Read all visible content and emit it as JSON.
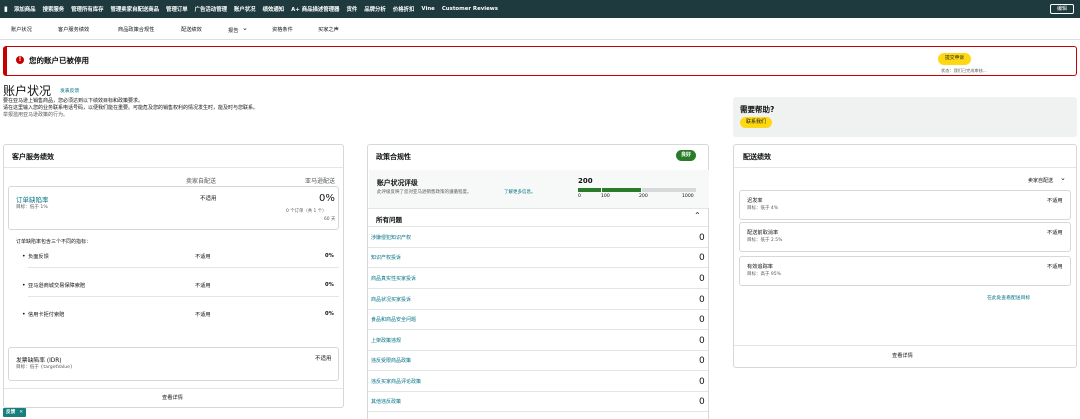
{
  "topnav": {
    "items": [
      "添加商品",
      "搜索服务",
      "管理所有库存",
      "管理卖家自配送商品",
      "管理订单",
      "广告活动管理",
      "账户状况",
      "绩效通知",
      "A+ 商品描述管理器",
      "货件",
      "品牌分析",
      "价格折扣",
      "Vine",
      "Customer Reviews"
    ],
    "edit_label": "编辑"
  },
  "subnav": {
    "items": [
      "账户状况",
      "客户服务绩效",
      "商品政策合规性",
      "配送绩效",
      "报告",
      "资格条件",
      "买家之声"
    ]
  },
  "alert": {
    "icon_char": "!",
    "message": "您的账户已被停用",
    "appeal_label": "提交申诉",
    "appeal_status": "状态：我们已完成审核..."
  },
  "header": {
    "title": "账户状况",
    "feedback_link": "发表反馈",
    "desc_lines": [
      "要在亚马逊上销售商品，您必须达到以下绩效目标和政策要求。",
      "请在这里输入您的业务联系电话号码，以便我们能在重要。可能危及您的销售权利的情况发生时，能及时与您联系。"
    ],
    "desc_muted": "举报滥用亚马逊政策的行为。"
  },
  "help": {
    "title": "需要帮助?",
    "button": "联系我们"
  },
  "customer_service": {
    "title": "客户服务绩效",
    "col_seller": "卖家自配送",
    "col_amazon": "亚马逊配送",
    "odr": {
      "name": "订单缺陷率",
      "target": "目标：低于 1%",
      "seller_value": "不适用",
      "amazon_value": "0%",
      "orders_note": "0 个订单（共 1 个）",
      "days": "60 天"
    },
    "odr_intro": "订单缺陷率包含三个不同的指标：",
    "sub_metrics": [
      {
        "name": "负面反馈",
        "seller": "不适用",
        "amazon": "0%"
      },
      {
        "name": "亚马逊商城交易保障索赔",
        "seller": "不适用",
        "amazon": "0%"
      },
      {
        "name": "信用卡拒付索赔",
        "seller": "不适用",
        "amazon": "0%"
      }
    ],
    "idr": {
      "name": "发票缺陷率 (IDR)",
      "target": "目标：低于 {targetValue}",
      "value": "不适用"
    },
    "details_link": "查看详情"
  },
  "policy": {
    "title": "政策合规性",
    "badge": "良好",
    "ahr_title": "账户状况评级",
    "ahr_desc": "此评级反映了您对亚马逊销售政策的遵循程度。",
    "ahr_learn": "了解更多信息。",
    "score": "200",
    "scale_labels": [
      "0",
      "100",
      "200",
      "1000"
    ],
    "all_issues": "所有问题",
    "issues": [
      {
        "name": "涉嫌侵犯知识产权",
        "count": "0"
      },
      {
        "name": "知识产权投诉",
        "count": "0"
      },
      {
        "name": "商品真实性买家投诉",
        "count": "0"
      },
      {
        "name": "商品状况买家投诉",
        "count": "0"
      },
      {
        "name": "食品和商品安全问题",
        "count": "0"
      },
      {
        "name": "上架政策违规",
        "count": "0"
      },
      {
        "name": "违反受限商品政策",
        "count": "0"
      },
      {
        "name": "违反买家商品评论政策",
        "count": "0"
      },
      {
        "name": "其他违反政策",
        "count": "0"
      }
    ],
    "colors": {
      "good": "#2a7c2a",
      "gray": "#d5d9d9"
    }
  },
  "shipping": {
    "title": "配送绩效",
    "filter": "卖家自配送",
    "metrics": [
      {
        "name": "迟发率",
        "target": "目标：低于 4%",
        "value": "不适用"
      },
      {
        "name": "配送前取消率",
        "target": "目标：低于 2.5%",
        "value": "不适用"
      },
      {
        "name": "有效追踪率",
        "target": "目标：高于 95%",
        "value": "不适用"
      }
    ],
    "view_targets": "在此处查看配送目标",
    "details_link": "查看详情"
  },
  "bottom_tag": {
    "label": "反馈",
    "close": "✕"
  }
}
